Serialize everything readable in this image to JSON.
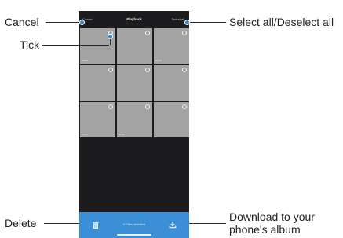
{
  "callouts": {
    "cancel": "Cancel",
    "tick": "Tick",
    "select_all": "Select all/Deselect all",
    "delete": "Delete",
    "download_line1": "Download to your",
    "download_line2": "phone's album"
  },
  "app": {
    "cancel_label": "Cancel",
    "title": "Playback",
    "select_all_label": "Select all",
    "grid": [
      {
        "time": "00:00"
      },
      {
        "time": ""
      },
      {
        "time": "00:15"
      },
      {
        "time": ""
      },
      {
        "time": ""
      },
      {
        "time": ""
      },
      {
        "time": "00:00"
      },
      {
        "time": "00:00"
      },
      {
        "time": ""
      }
    ],
    "files_selected": "0 Files selected"
  },
  "colors": {
    "accent": "#3a8fd6",
    "dot": "#2b8fd9",
    "screen_bg": "#1c1c1e",
    "thumb": "#a3a3a3"
  },
  "icons": {
    "delete": "trash-icon",
    "download": "download-icon",
    "tick": "circle-icon"
  }
}
